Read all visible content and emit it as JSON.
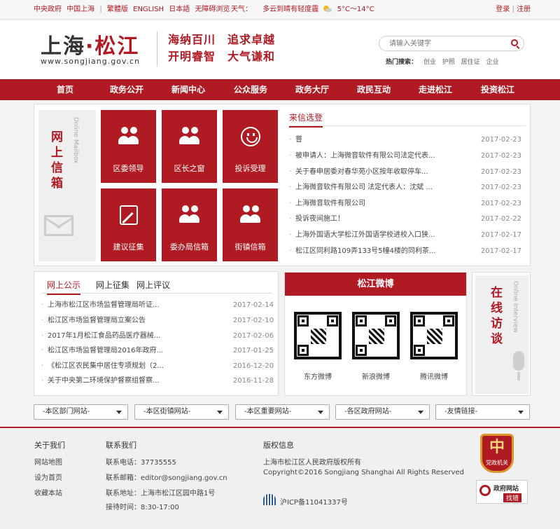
{
  "topbar": {
    "links": [
      "中央政府",
      "中国上海",
      "繁體版",
      "ENGLISH",
      "日本語",
      "无障碍浏览"
    ],
    "weather_label": "天气：",
    "weather_text": "多云到晴有轻度霾",
    "temperature": "5°C～14°C",
    "login": "登录",
    "divider": "|",
    "register": "注册"
  },
  "header": {
    "logo_part1": "上海",
    "logo_dot": "·",
    "logo_part2": "松江",
    "logo_url": "www.songjiang.gov.cn",
    "slogan_line1": "海纳百川　追求卓越",
    "slogan_line2": "开明睿智　大气谦和",
    "search_placeholder": "请输入关键字",
    "hot_label": "热门搜索：",
    "hot_items": [
      "创业",
      "护照",
      "居住证",
      "企业"
    ]
  },
  "nav": [
    "首页",
    "政务公开",
    "新闻中心",
    "公众服务",
    "政务大厅",
    "政民互动",
    "走进松江",
    "投资松江"
  ],
  "mailbox": {
    "title": "网上信箱",
    "subtitle": "Online Mailbox",
    "tiles": [
      "区委领导",
      "区长之窗",
      "投诉受理",
      "建议征集",
      "委办局信箱",
      "街镇信箱"
    ]
  },
  "letters": {
    "title": "来信选登",
    "items": [
      {
        "text": "嘗",
        "date": "2017-02-23"
      },
      {
        "text": "被申请人：上海微音软件有限公司法定代表...",
        "date": "2017-02-23"
      },
      {
        "text": "关于春申居委对春华苑小区按年收取停车...",
        "date": "2017-02-23"
      },
      {
        "text": "上海微音软件有限公司 法定代表人：沈斌 ...",
        "date": "2017-02-23"
      },
      {
        "text": "上海微音软件有限公司",
        "date": "2017-02-23"
      },
      {
        "text": "投诉夜间施工！",
        "date": "2017-02-22"
      },
      {
        "text": "上海外国语大学松江外国语学校进校入口狭...",
        "date": "2017-02-17"
      },
      {
        "text": "松江区同利路109弄133号5幢4楼的同利茶...",
        "date": "2017-02-17"
      }
    ]
  },
  "public_tabs": {
    "tabs": [
      "网上公示",
      "网上征集",
      "网上评议"
    ],
    "items": [
      {
        "text": "上海市松江区市场监督管理局听证...",
        "date": "2017-02-14"
      },
      {
        "text": "松江区市场监督管理局立案公告",
        "date": "2017-02-10"
      },
      {
        "text": "2017年1月松江食品药品医疗器械...",
        "date": "2017-02-06"
      },
      {
        "text": "松江区市场监督管理局2016年政府...",
        "date": "2017-01-25"
      },
      {
        "text": "《松江区农民集中居住专项规划（2...",
        "date": "2016-12-20"
      },
      {
        "text": "关于中央第二环境保护督察组督察...",
        "date": "2016-11-28"
      }
    ]
  },
  "weibo": {
    "title": "松江微博",
    "labels": [
      "东方微博",
      "新浪微博",
      "腾讯微博"
    ]
  },
  "interview": {
    "title": "在线访谈",
    "subtitle": "Online Interview"
  },
  "selects": [
    "-本区部门网站-",
    "-本区街镇网站-",
    "-本区重要网站-",
    "-各区政府网站-",
    "-友情链接-"
  ],
  "footer": {
    "about_title": "关于我们",
    "about_links": [
      "网站地图",
      "设为首页",
      "收藏本站"
    ],
    "contact_title": "联系我们",
    "contact_lines": [
      "联系电话：37735555",
      "联系邮箱：editor@songjiang.gov.cn",
      "联系地址：上海市松江区园中路1号",
      "接待时间：8:30-17:00"
    ],
    "copyright_title": "版权信息",
    "copyright_lines": [
      "上海市松江区人民政府版权所有",
      "Copyright©2016 Songjiang Shanghai All Rights Reserved"
    ],
    "icp": "沪ICP备11041337号",
    "badge_text": "党政机关",
    "gov_site_text": "政府网站",
    "gov_site_sub": "找错"
  },
  "colors": {
    "brand_red": "#b01a23",
    "badge_gold": "#d89b2b"
  }
}
